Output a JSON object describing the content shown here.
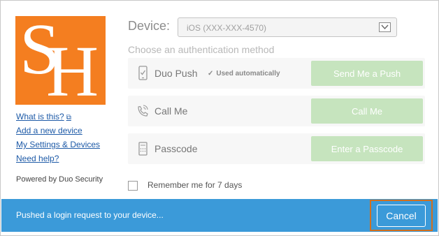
{
  "logo": {
    "letters": "SH"
  },
  "links": {
    "what_is_this": "What is this?",
    "add_device": "Add a new device",
    "settings": "My Settings & Devices",
    "help": "Need help?"
  },
  "powered_by": "Powered by Duo Security",
  "device": {
    "label": "Device:",
    "selected": "iOS (XXX-XXX-4570)"
  },
  "choose_method": "Choose an authentication method",
  "methods": [
    {
      "label": "Duo Push",
      "note": "Used automatically",
      "button": "Send Me a Push",
      "icon": "phone-icon"
    },
    {
      "label": "Call Me",
      "button": "Call Me",
      "icon": "phone-call-icon"
    },
    {
      "label": "Passcode",
      "button": "Enter a Passcode",
      "icon": "passcode-icon"
    }
  ],
  "remember": "Remember me for 7 days",
  "status": {
    "message": "Pushed a login request to your device...",
    "cancel": "Cancel"
  },
  "colors": {
    "logo_bg": "#f47e20",
    "status_bg": "#3b9ad9",
    "method_button": "#c6e4be",
    "link": "#1d5aa7",
    "cancel_highlight": "#d0701f"
  }
}
